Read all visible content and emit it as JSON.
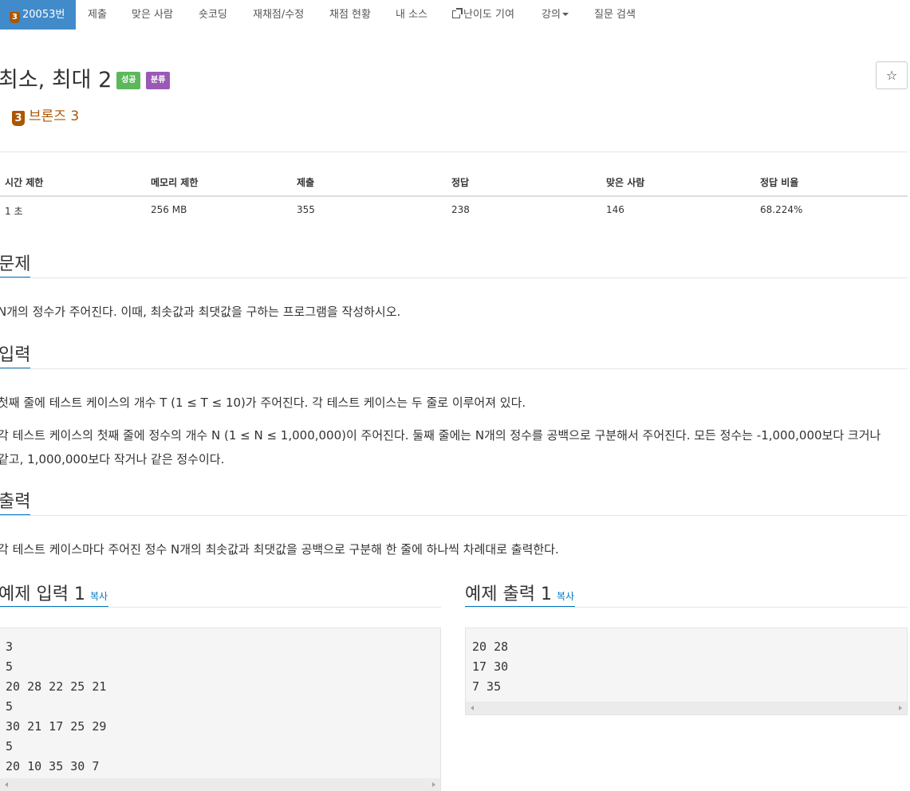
{
  "nav": {
    "problem_badge": "3",
    "problem_number": "20053번",
    "items": [
      "제출",
      "맞은 사람",
      "숏코딩",
      "재채점/수정",
      "채점 현황",
      "내 소스",
      "난이도 기여",
      "강의",
      "질문 검색"
    ]
  },
  "problem": {
    "title": "최소, 최대 2",
    "label_success": "성공",
    "label_category": "분류",
    "star": "☆",
    "tier_badge": "3",
    "tier_text": "브론즈 3"
  },
  "info_table": {
    "headers": [
      "시간 제한",
      "메모리 제한",
      "제출",
      "정답",
      "맞은 사람",
      "정답 비율"
    ],
    "values": [
      "1 초",
      "256 MB",
      "355",
      "238",
      "146",
      "68.224%"
    ]
  },
  "sections": {
    "problem_title": "문제",
    "problem_text": "N개의 정수가 주어진다. 이때, 최솟값과 최댓값을 구하는 프로그램을 작성하시오.",
    "input_title": "입력",
    "input_text_1": "첫째 줄에 테스트 케이스의 개수 T (1 ≤ T ≤ 10)가 주어진다. 각 테스트 케이스는 두 줄로 이루어져 있다.",
    "input_text_2a": "각 테스트 케이스의 첫째 줄에 정수의 개수 N (1 ≤ N ≤ 1,000,000)이 주어진다. 둘째 줄에는 N개의 정수를 공백으로 구분해서 주어진다. 모든 정수는 -1,000,000보다 크거나",
    "input_text_2b": "같고, 1,000,000보다 작거나 같은 정수이다.",
    "output_title": "출력",
    "output_text": "각 테스트 케이스마다 주어진 정수 N개의 최솟값과 최댓값을 공백으로 구분해 한 줄에 하나씩 차례대로 출력한다."
  },
  "samples": {
    "input_title": "예제 입력 1",
    "output_title": "예제 출력 1",
    "copy_label": "복사",
    "input_lines": [
      "3",
      "5",
      "20 28 22 25 21",
      "5",
      "30 21 17 25 29",
      "5",
      "20 10 35 30 7"
    ],
    "output_lines": [
      "20 28",
      "17 30",
      "7 35"
    ]
  }
}
